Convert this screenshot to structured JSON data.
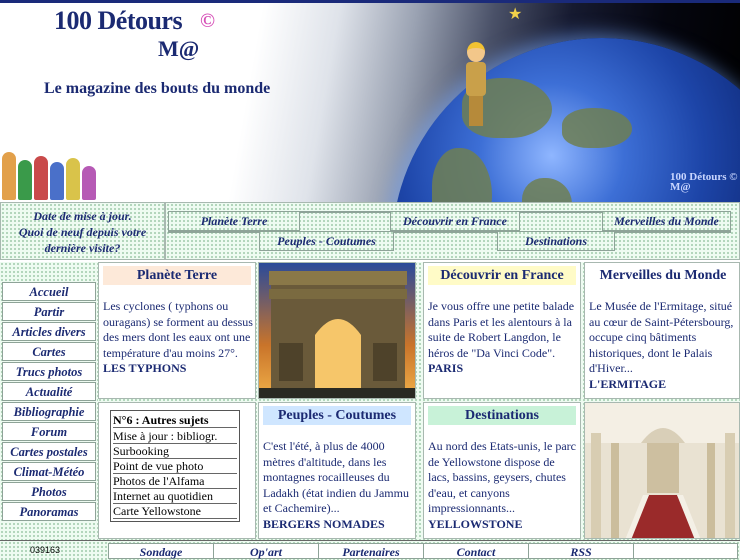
{
  "header": {
    "logo_title": "100 Détours",
    "logo_sub": "M@",
    "logo_c": "©",
    "tagline": "Le magazine des bouts du monde",
    "corner_logo": "100 Détours ©\nM@"
  },
  "update_box": {
    "line1": "Date de mise à jour.",
    "line2": "Quoi de neuf depuis votre",
    "line3": "dernière visite?"
  },
  "top_nav": {
    "planete": "Planète Terre",
    "decouvrir": "Découvrir en France",
    "merveilles": "Merveilles du Monde",
    "peuples": "Peuples - Coutumes",
    "destinations": "Destinations"
  },
  "left_menu": [
    "Accueil",
    "Partir",
    "Articles divers",
    "Cartes",
    "Trucs photos",
    "Actualité",
    "Bibliographie",
    "Forum",
    "Cartes postales",
    "Climat-Météo",
    "Photos",
    "Panoramas"
  ],
  "panels": {
    "planete": {
      "title": "Planète Terre",
      "text": "Les cyclones ( typhons ou ouragans) se forment au dessus des mers dont les eaux ont une température d'au moins 27°.",
      "footer": "LES TYPHONS",
      "title_bg": "#fde9d9"
    },
    "decouvrir": {
      "title": "Découvrir en France",
      "text": "Je vous offre une petite balade dans Paris et les alentours à la suite de Robert Langdon, le héros de \"Da Vinci Code\".",
      "footer": "PARIS",
      "title_bg": "#fffbc7"
    },
    "merveilles": {
      "title": "Merveilles du Monde",
      "text": "Le Musée de l'Ermitage, situé au cœur de Saint-Pétersbourg, occupe cinq bâtiments historiques, dont le Palais d'Hiver...",
      "footer": "L'ERMITAGE",
      "title_bg": "#ffffff"
    },
    "peuples": {
      "title": "Peuples - Coutumes",
      "text": "C'est l'été, à plus de 4000 mètres d'altitude, dans les montagnes rocailleuses du Ladakh (état indien du Jammu et Cachemire)...",
      "footer": "BERGERS NOMADES",
      "title_bg": "#cfe6ff"
    },
    "destinations": {
      "title": "Destinations",
      "text": "Au nord des Etats-unis, le parc de Yellowstone dispose de lacs, bassins, geysers, chutes d'eau, et canyons impressionnants...",
      "footer": "YELLOWSTONE",
      "title_bg": "#c8f2d8"
    }
  },
  "subjects": {
    "title": "N°6 : Autres sujets",
    "items": [
      "Mise à jour : bibliogr.",
      "Surbooking",
      "Point de vue photo",
      "Photos de l'Alfama",
      "Internet au quotidien",
      "Carte Yellowstone"
    ]
  },
  "footer": {
    "counter": "039163",
    "links": [
      "Sondage",
      "Op'art",
      "Partenaires",
      "Contact",
      "RSS"
    ]
  },
  "colors": {
    "text_blue": "#1b2a72",
    "cell_bg": "#eefbf1"
  }
}
